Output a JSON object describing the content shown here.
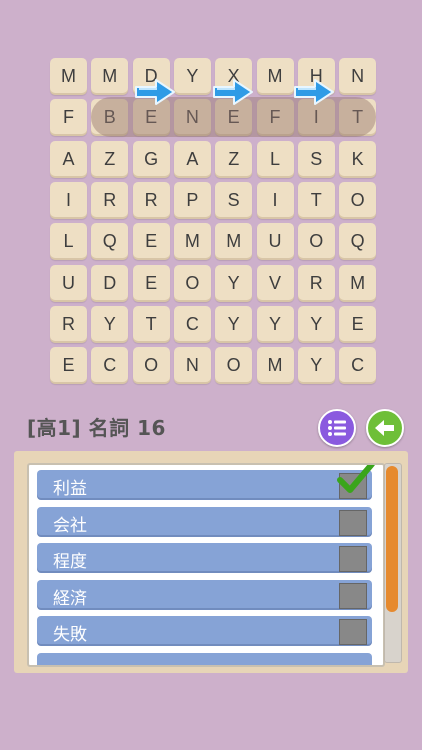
{
  "grid": [
    [
      "M",
      "M",
      "D",
      "Y",
      "X",
      "M",
      "H",
      "N"
    ],
    [
      "F",
      "B",
      "E",
      "N",
      "E",
      "F",
      "I",
      "T"
    ],
    [
      "A",
      "Z",
      "G",
      "A",
      "Z",
      "L",
      "S",
      "K"
    ],
    [
      "I",
      "R",
      "R",
      "P",
      "S",
      "I",
      "T",
      "O"
    ],
    [
      "L",
      "Q",
      "E",
      "M",
      "M",
      "U",
      "O",
      "Q"
    ],
    [
      "U",
      "D",
      "E",
      "O",
      "Y",
      "V",
      "R",
      "M"
    ],
    [
      "R",
      "Y",
      "T",
      "C",
      "Y",
      "Y",
      "Y",
      "E"
    ],
    [
      "E",
      "C",
      "O",
      "N",
      "O",
      "M",
      "Y",
      "C"
    ]
  ],
  "header": {
    "title": "[高1] 名詞 16"
  },
  "words": [
    {
      "label": "利益",
      "checked": true
    },
    {
      "label": "会社",
      "checked": false
    },
    {
      "label": "程度",
      "checked": false
    },
    {
      "label": "経済",
      "checked": false
    },
    {
      "label": "失敗",
      "checked": false
    }
  ],
  "scroll": {
    "position_fraction": 0.0
  },
  "colors": {
    "background": "#cdb0cb",
    "tile": "#eedfc4",
    "row": "#86a3d6",
    "check": "#3aa51b",
    "scroll_thumb": "#e68a2e"
  }
}
